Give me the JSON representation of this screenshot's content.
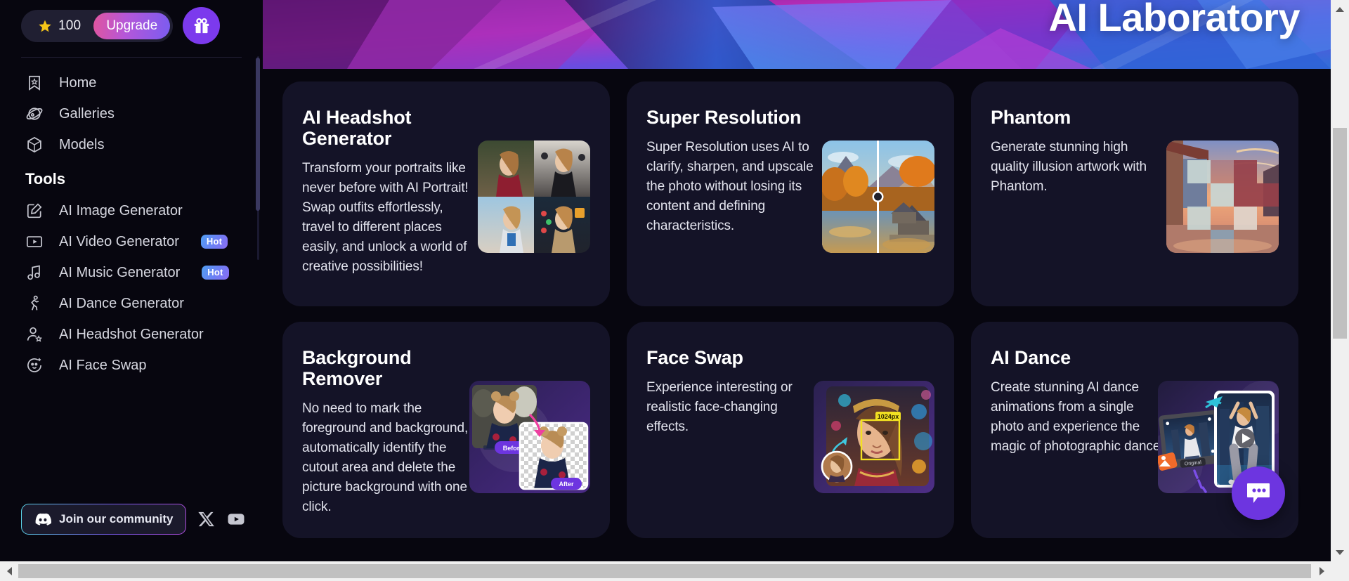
{
  "sidebar": {
    "credits": {
      "icon": "star-icon",
      "value": "100"
    },
    "upgrade_label": "Upgrade",
    "gift_icon": "gift-icon",
    "nav_primary": [
      {
        "label": "Home",
        "icon": "bookmark-star-icon"
      },
      {
        "label": "Galleries",
        "icon": "planet-icon"
      },
      {
        "label": "Models",
        "icon": "cube-icon"
      }
    ],
    "tools_title": "Tools",
    "nav_tools": [
      {
        "label": "AI Image Generator",
        "icon": "pencil-square-icon",
        "badge": ""
      },
      {
        "label": "AI Video Generator",
        "icon": "video-play-icon",
        "badge": "Hot"
      },
      {
        "label": "AI Music Generator",
        "icon": "music-note-icon",
        "badge": "Hot"
      },
      {
        "label": "AI Dance Generator",
        "icon": "dancing-person-icon",
        "badge": ""
      },
      {
        "label": "AI Headshot Generator",
        "icon": "person-star-icon",
        "badge": ""
      },
      {
        "label": "AI Face Swap",
        "icon": "face-swap-icon",
        "badge": ""
      }
    ],
    "community_label": "Join our community",
    "community_icon": "discord-icon",
    "socials": [
      {
        "name": "x-twitter-icon"
      },
      {
        "name": "youtube-icon"
      }
    ]
  },
  "hero": {
    "title": "AI Laboratory"
  },
  "cards": [
    {
      "title": "AI Headshot Generator",
      "desc": "Transform your portraits like never before with AI Portrait! Swap outfits effortlessly, travel to different places easily, and unlock a world of creative possibilities!",
      "thumb": "portrait-grid-thumbnail"
    },
    {
      "title": "Super Resolution",
      "desc": "Super Resolution uses AI to clarify, sharpen, and upscale the photo without losing its content and defining characteristics.",
      "thumb": "landscape-compare-thumbnail"
    },
    {
      "title": "Phantom",
      "desc": "Generate stunning high quality illusion artwork with Phantom.",
      "thumb": "checkerboard-illusion-thumbnail"
    },
    {
      "title": "Background Remover",
      "desc": "No need to mark the foreground and background, automatically identify the cutout area and delete the picture background with one click.",
      "thumb": "before-after-cutout-thumbnail",
      "labels": {
        "before": "Before",
        "after": "After"
      }
    },
    {
      "title": "Face Swap",
      "desc": "Experience interesting or realistic face-changing effects.",
      "thumb": "face-detect-thumbnail",
      "labels": {
        "size": "1024px"
      }
    },
    {
      "title": "AI Dance",
      "desc": "Create stunning AI dance animations from a single photo and experience the magic of photographic dance.",
      "thumb": "dance-video-thumbnail",
      "labels": {
        "original": "Original"
      }
    }
  ],
  "chat_fab": {
    "icon": "chat-bubble-icon"
  },
  "colors": {
    "page_bg": "#07060f",
    "card_bg": "#141327",
    "accent_purple": "#7c3aed",
    "hot_badge": "#6d7ef5",
    "star_yellow": "#f5c518"
  }
}
